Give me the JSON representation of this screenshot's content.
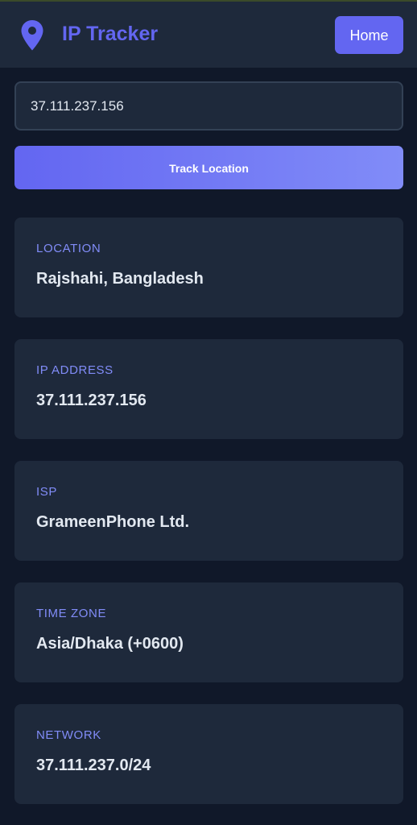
{
  "header": {
    "title": "IP Tracker",
    "home_label": "Home",
    "logo_icon": "location-pin-icon"
  },
  "search": {
    "value": "37.111.237.156",
    "button_label": "Track Location"
  },
  "results": [
    {
      "label": "LOCATION",
      "value": "Rajshahi, Bangladesh"
    },
    {
      "label": "IP ADDRESS",
      "value": "37.111.237.156"
    },
    {
      "label": "ISP",
      "value": "GrameenPhone Ltd."
    },
    {
      "label": "TIME ZONE",
      "value": "Asia/Dhaka (+0600)"
    },
    {
      "label": "NETWORK",
      "value": "37.111.237.0/24"
    }
  ],
  "colors": {
    "accent": "#6366f1",
    "accent_light": "#818cf8",
    "background": "#101829",
    "surface": "#1e293b",
    "text": "#e2e8f0"
  }
}
